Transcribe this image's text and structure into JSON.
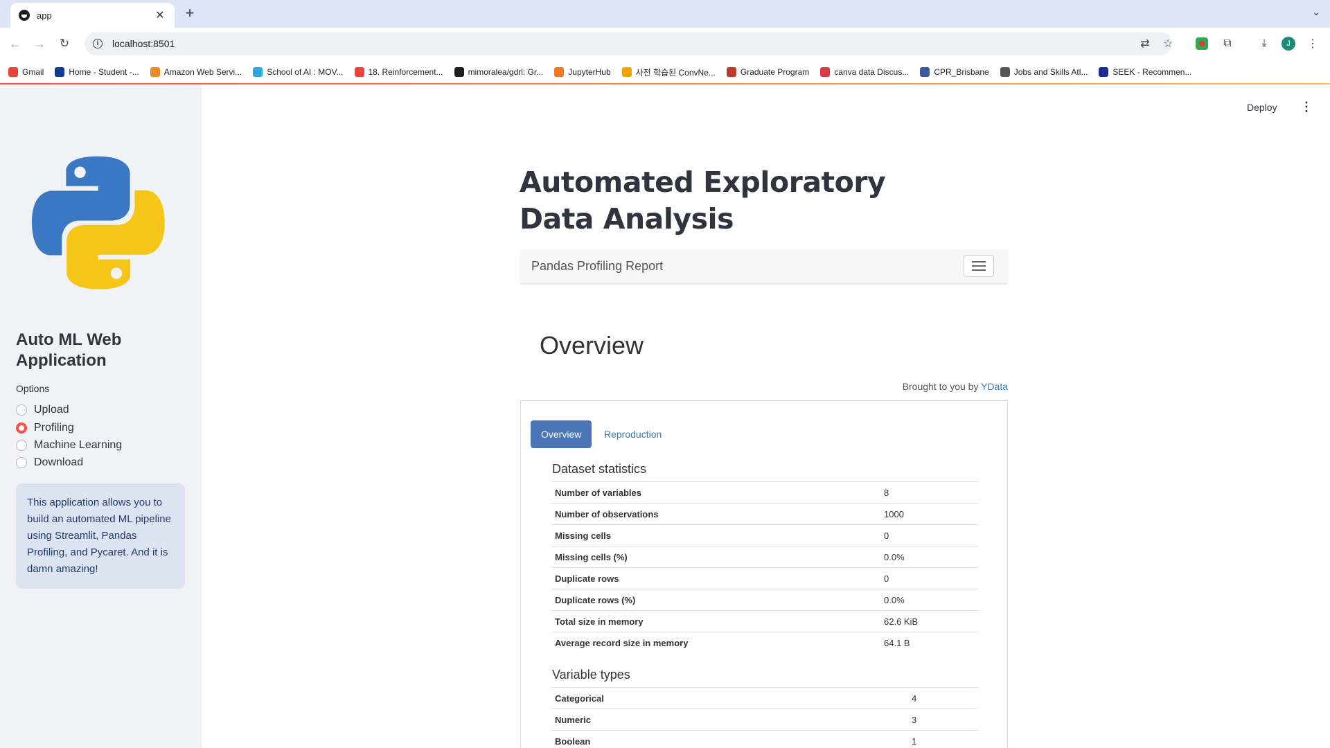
{
  "browser": {
    "tab_title": "app",
    "url": "localhost:8501",
    "bookmarks": [
      {
        "label": "Gmail",
        "color": "#ea4335"
      },
      {
        "label": "Home - Student -...",
        "color": "#0b3d91"
      },
      {
        "label": "Amazon Web Servi...",
        "color": "#f08a24"
      },
      {
        "label": "School of AI : MOV...",
        "color": "#2aa6e0"
      },
      {
        "label": "18. Reinforcement...",
        "color": "#e8453c"
      },
      {
        "label": "mimoralea/gdrl: Gr...",
        "color": "#1f1f1f"
      },
      {
        "label": "JupyterHub",
        "color": "#f37726"
      },
      {
        "label": "사전 학습된 ConvNe...",
        "color": "#f4a300"
      },
      {
        "label": "Graduate Program",
        "color": "#c0392b"
      },
      {
        "label": "canva data Discus...",
        "color": "#d93a4a"
      },
      {
        "label": "CPR_Brisbane",
        "color": "#3c5a9a"
      },
      {
        "label": "Jobs and Skills Atl...",
        "color": "#555555"
      },
      {
        "label": "SEEK - Recommen...",
        "color": "#1c2b8f"
      }
    ],
    "avatar_initial": "J"
  },
  "sidebar": {
    "title": "Auto ML Web Application",
    "options_label": "Options",
    "options": [
      {
        "label": "Upload",
        "selected": false
      },
      {
        "label": "Profiling",
        "selected": true
      },
      {
        "label": "Machine Learning",
        "selected": false
      },
      {
        "label": "Download",
        "selected": false
      }
    ],
    "info": "This application allows you to build an automated ML pipeline using Streamlit, Pandas Profiling, and Pycaret. And it is damn amazing!"
  },
  "header": {
    "deploy_label": "Deploy"
  },
  "main": {
    "title": "Automated Exploratory Data Analysis",
    "report_brand": "Pandas Profiling Report",
    "section_title": "Overview",
    "brought_prefix": "Brought to you by ",
    "brought_link": "YData",
    "tabs": [
      {
        "label": "Overview",
        "active": true
      },
      {
        "label": "Reproduction",
        "active": false
      }
    ],
    "dataset_statistics": {
      "title": "Dataset statistics",
      "rows": [
        {
          "key": "Number of variables",
          "value": "8"
        },
        {
          "key": "Number of observations",
          "value": "1000"
        },
        {
          "key": "Missing cells",
          "value": "0"
        },
        {
          "key": "Missing cells (%)",
          "value": "0.0%"
        },
        {
          "key": "Duplicate rows",
          "value": "0"
        },
        {
          "key": "Duplicate rows (%)",
          "value": "0.0%"
        },
        {
          "key": "Total size in memory",
          "value": "62.6 KiB"
        },
        {
          "key": "Average record size in memory",
          "value": "64.1 B"
        }
      ]
    },
    "variable_types": {
      "title": "Variable types",
      "rows": [
        {
          "key": "Categorical",
          "value": "4"
        },
        {
          "key": "Numeric",
          "value": "3"
        },
        {
          "key": "Boolean",
          "value": "1"
        }
      ]
    }
  }
}
